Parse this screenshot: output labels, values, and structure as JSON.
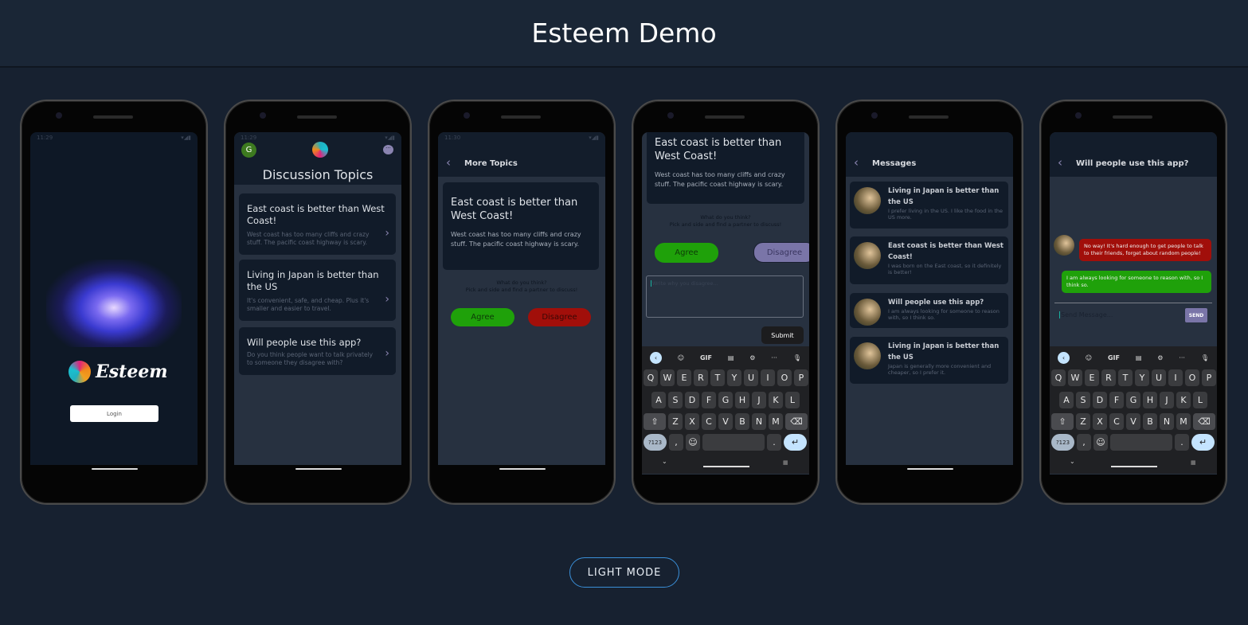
{
  "page": {
    "title": "Esteem Demo",
    "mode_button": "LIGHT MODE"
  },
  "colors": {
    "agree": "#1fa10a",
    "disagree": "#a10f0a",
    "disagree_selected": "#7a75a8",
    "accent": "#8a84b0",
    "mode_border": "#3a8fd8"
  },
  "status": {
    "t1": "11:29",
    "t2": "11:30"
  },
  "login": {
    "brand": "Esteem",
    "login_button": "Login"
  },
  "topics": {
    "avatar_letter": "G",
    "title": "Discussion Topics",
    "items": [
      {
        "title": "East coast is better than West Coast!",
        "desc": "West coast has too many cliffs and crazy stuff.  The pacific coast highway is scary."
      },
      {
        "title": "Living in Japan is better than the US",
        "desc": "It's convenient, safe, and cheap. Plus it's smaller and easier to travel."
      },
      {
        "title": "Will people use this app?",
        "desc": "Do you think people want to talk privately to someone they disagree with?"
      }
    ]
  },
  "detail": {
    "header": "More Topics",
    "title": "East coast is better than West Coast!",
    "desc": "West coast has too many cliffs and crazy stuff.  The pacific coast highway is scary.",
    "prompt1": "What do you think?",
    "prompt2": "Pick and side and find a partner to discuss!",
    "agree": "Agree",
    "disagree": "Disagree",
    "reason_placeholder": "Write why you disagree...",
    "submit": "Submit"
  },
  "keyboard": {
    "rows": [
      [
        "Q",
        "W",
        "E",
        "R",
        "T",
        "Y",
        "U",
        "I",
        "O",
        "P"
      ],
      [
        "A",
        "S",
        "D",
        "F",
        "G",
        "H",
        "J",
        "K",
        "L"
      ],
      [
        "Z",
        "X",
        "C",
        "V",
        "B",
        "N",
        "M"
      ]
    ],
    "symbols": "?123",
    "gif": "GIF",
    "more": "···"
  },
  "messages": {
    "header": "Messages",
    "items": [
      {
        "title": "Living in Japan is better than the US",
        "preview": "I prefer living in the US. I like the food in the US more."
      },
      {
        "title": "East coast is better than West Coast!",
        "preview": "I was born on the East coast, so it definitely is better!"
      },
      {
        "title": "Will people use this app?",
        "preview": "I am always looking for someone to reason with, so I think so."
      },
      {
        "title": "Living in Japan is better than the US",
        "preview": "Japan is generally more convenient and cheaper, so I prefer it."
      }
    ]
  },
  "chat": {
    "header": "Will people use this app?",
    "received": "No way! It's hard enough to get people to talk to their friends, forget about random people!",
    "sent": "I am always looking for someone to reason with, so I think so.",
    "placeholder": "Send Message...",
    "send": "SEND"
  }
}
